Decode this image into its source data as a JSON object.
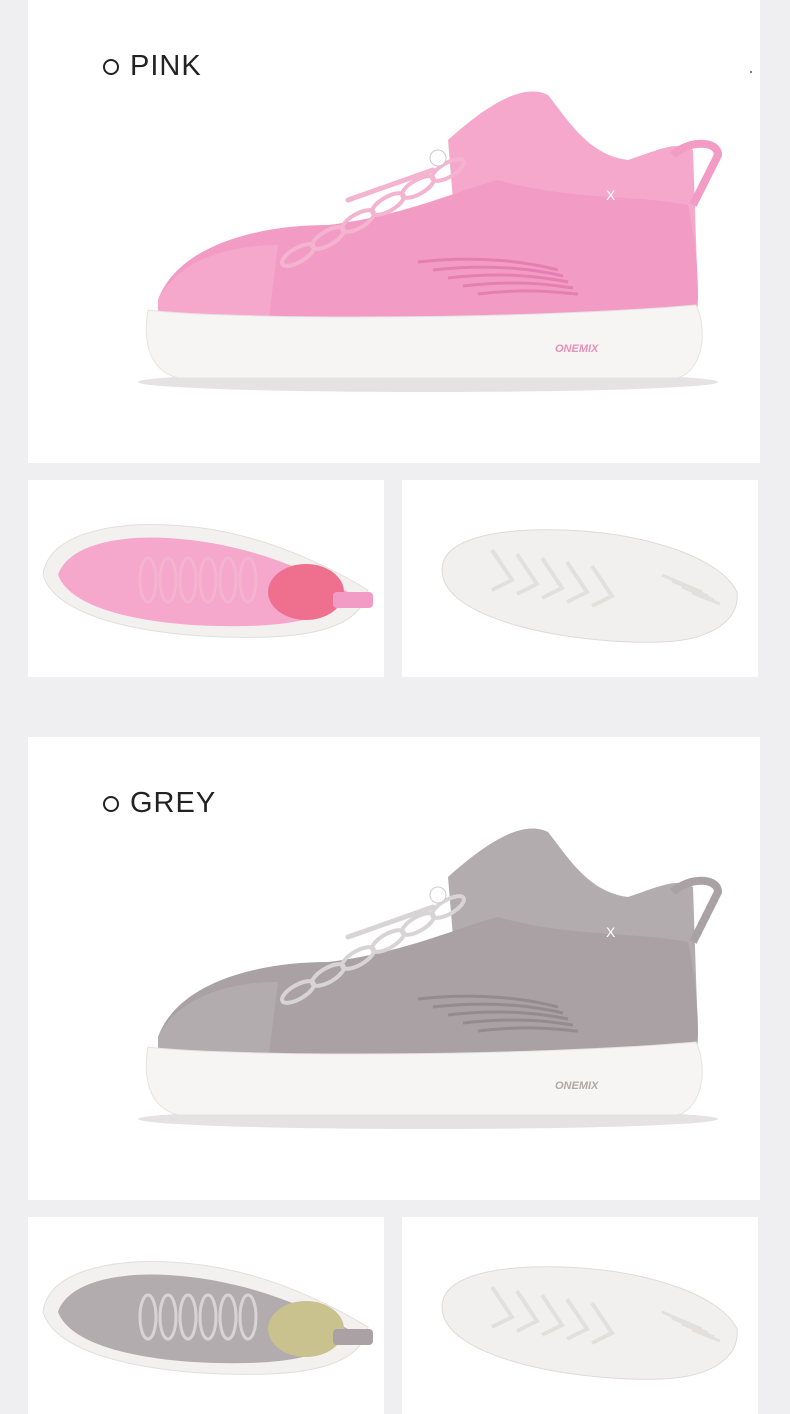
{
  "sections": [
    {
      "color_name": "PINK",
      "upper_color": "#f29bc4",
      "upper_dark": "#e57fb0",
      "knit_color": "#f5a8cb",
      "lace_color": "#f4b4d0",
      "insole_color": "#ef6f8f",
      "logo_color": "#e88fb8",
      "main_shoe_alt": "pink-shoe-side-view",
      "top_shoe_alt": "pink-shoe-top-view",
      "sole_alt": "pink-shoe-outsole-view"
    },
    {
      "color_name": "GREY",
      "upper_color": "#a9a1a3",
      "upper_dark": "#938b8d",
      "knit_color": "#b3acae",
      "lace_color": "#d8d4d5",
      "insole_color": "#c9c18e",
      "logo_color": "#b0a9a0",
      "main_shoe_alt": "grey-shoe-side-view",
      "top_shoe_alt": "grey-shoe-top-view",
      "sole_alt": "grey-shoe-outsole-view"
    }
  ],
  "brand_logo_text": "ONEMIX"
}
